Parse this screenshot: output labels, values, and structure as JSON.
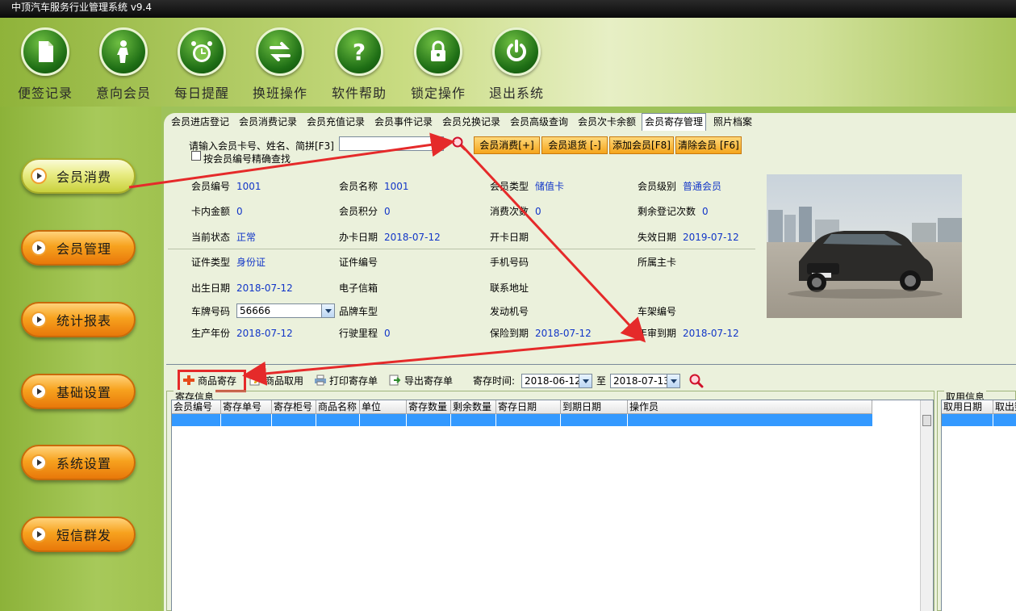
{
  "window": {
    "title": "中顶汽车服务行业管理系统 v9.4"
  },
  "top_toolbar": [
    {
      "label": "便签记录",
      "icon": "note-icon"
    },
    {
      "label": "意向会员",
      "icon": "person-icon"
    },
    {
      "label": "每日提醒",
      "icon": "alarm-clock-icon"
    },
    {
      "label": "换班操作",
      "icon": "swap-arrows-icon"
    },
    {
      "label": "软件帮助",
      "icon": "question-icon"
    },
    {
      "label": "锁定操作",
      "icon": "lock-icon"
    },
    {
      "label": "退出系统",
      "icon": "power-icon"
    }
  ],
  "sidebar": [
    {
      "label": "会员消费",
      "style": "yellow"
    },
    {
      "label": "会员管理",
      "style": "orange"
    },
    {
      "label": "统计报表",
      "style": "orange"
    },
    {
      "label": "基础设置",
      "style": "orange"
    },
    {
      "label": "系统设置",
      "style": "orange"
    },
    {
      "label": "短信群发",
      "style": "orange"
    }
  ],
  "search": {
    "label": "请输入会员卡号、姓名、简拼[F3]",
    "value": "",
    "exact_label": "按会员编号精确查找",
    "exact_checked": false
  },
  "actions": {
    "consume": "会员消费[+]",
    "refund": "会员退货 [-]",
    "add": "添加会员[F8]",
    "clear": "清除会员 [F6]"
  },
  "member": {
    "id_label": "会员编号",
    "id": "1001",
    "name_label": "会员名称",
    "name": "1001",
    "type_label": "会员类型",
    "type": "储值卡",
    "level_label": "会员级别",
    "level": "普通会员",
    "balance_label": "卡内金额",
    "balance": "0",
    "points_label": "会员积分",
    "points": "0",
    "consume_count_label": "消费次数",
    "consume_count": "0",
    "remaining_label": "剩余登记次数",
    "remaining": "0",
    "status_label": "当前状态",
    "status": "正常",
    "issue_date_label": "办卡日期",
    "issue_date": "2018-07-12",
    "open_date_label": "开卡日期",
    "open_date": "",
    "expire_date_label": "失效日期",
    "expire_date": "2019-07-12",
    "cert_type_label": "证件类型",
    "cert_type": "身份证",
    "cert_no_label": "证件编号",
    "cert_no": "",
    "phone_label": "手机号码",
    "phone": "",
    "main_card_label": "所属主卡",
    "main_card": "",
    "birth_label": "出生日期",
    "birth": "2018-07-12",
    "email_label": "电子信箱",
    "email": "",
    "address_label": "联系地址",
    "address": "",
    "plate_label": "车牌号码",
    "plate": "56666",
    "model_label": "品牌车型",
    "model": "",
    "engine_label": "发动机号",
    "engine": "",
    "vin_label": "车架编号",
    "vin": "",
    "year_label": "生产年份",
    "year": "2018-07-12",
    "mileage_label": "行驶里程",
    "mileage": "0",
    "insurance_label": "保险到期",
    "insurance": "2018-07-12",
    "inspection_label": "年审到期",
    "inspection": "2018-07-12"
  },
  "tabs": [
    "会员进店登记",
    "会员消费记录",
    "会员充值记录",
    "会员事件记录",
    "会员兑换记录",
    "会员高级查询",
    "会员次卡余额",
    "会员寄存管理",
    "照片档案"
  ],
  "active_tab": "会员寄存管理",
  "deposit_toolbar": {
    "deposit": "商品寄存",
    "take": "商品取用",
    "print": "打印寄存单",
    "export": "导出寄存单",
    "time_label": "寄存时间:",
    "date_from": "2018-06-12",
    "to_label": "至",
    "date_to": "2018-07-13"
  },
  "deposit_panel": {
    "title": "寄存信息",
    "columns": [
      "会员编号",
      "寄存单号",
      "寄存柜号",
      "商品名称",
      "单位",
      "寄存数量",
      "剩余数量",
      "寄存日期",
      "到期日期",
      "操作员"
    ]
  },
  "takeout_panel": {
    "title": "取用信息",
    "columns": [
      "取用日期",
      "取出数"
    ]
  },
  "colors": {
    "accent_orange": "#f5a51c",
    "value_blue": "#1236c8",
    "selection": "#3399ff",
    "highlight_red": "#e52a2a"
  }
}
